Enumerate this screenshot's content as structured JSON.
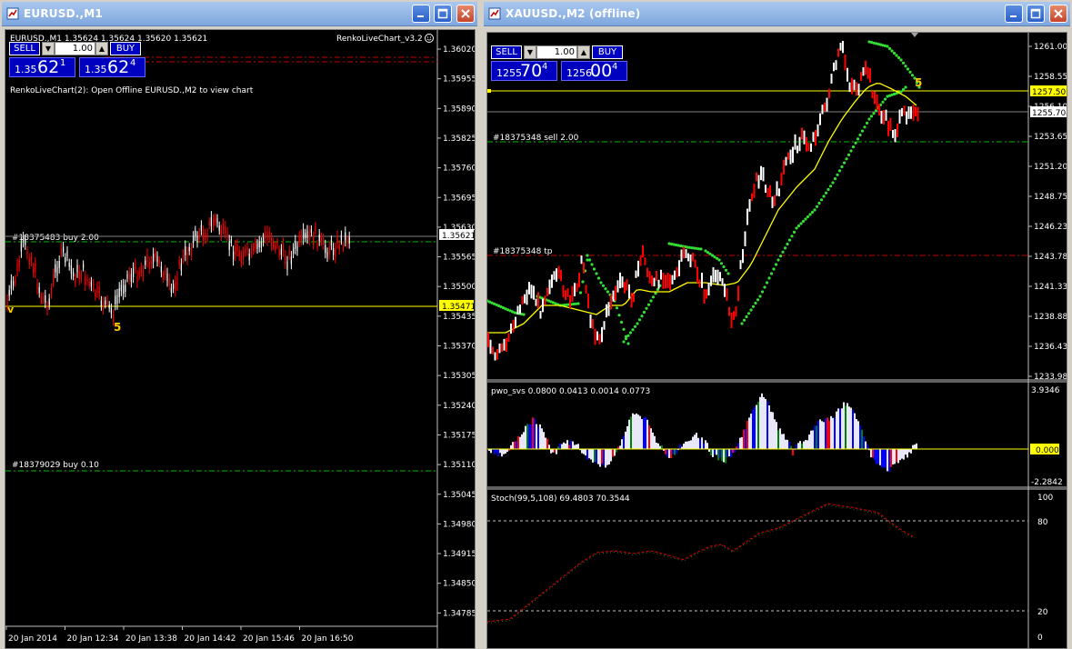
{
  "left_window": {
    "title": "EURUSD.,M1",
    "info_line": "EURUSD.,M1  1.35624 1.35624 1.35620 1.35621",
    "indicator_name": "RenkoLiveChart_v3.2",
    "comment": "RenkoLiveChart(2): Open Offline EURUSD.,M2 to view chart",
    "trade_panel": {
      "sell_label": "SELL",
      "buy_label": "BUY",
      "lot": "1.00",
      "sell_small": "1.35",
      "sell_big": "62",
      "sell_pip": "1",
      "buy_small": "1.35",
      "buy_big": "62",
      "buy_pip": "4"
    },
    "price_axis": [
      "1.36020",
      "1.35955",
      "1.35890",
      "1.35825",
      "1.35760",
      "1.35695",
      "1.35630",
      "1.35565",
      "1.35500",
      "1.35435",
      "1.35370",
      "1.35305",
      "1.35240",
      "1.35175",
      "1.35110",
      "1.35045",
      "1.34980",
      "1.34915",
      "1.34850",
      "1.34785"
    ],
    "current_price": "1.35621",
    "line_price": "1.35471",
    "order_lines": [
      {
        "label": "#18375483 buy 2.00"
      },
      {
        "label": "#18379029 buy 0.10"
      }
    ],
    "renko_marker": "5",
    "time_axis": [
      "20 Jan 2014",
      "20 Jan 12:34",
      "20 Jan 13:38",
      "20 Jan 14:42",
      "20 Jan 15:46",
      "20 Jan 16:50"
    ]
  },
  "right_window": {
    "title": "XAUUSD.,M2 (offline)",
    "trade_panel": {
      "sell_label": "SELL",
      "buy_label": "BUY",
      "lot": "1.00",
      "sell_small": "1255",
      "sell_big": "70",
      "sell_pip": "4",
      "buy_small": "1256",
      "buy_big": "00",
      "buy_pip": "4"
    },
    "price_axis": [
      "1261.000",
      "1258.550",
      "1256.100",
      "1253.650",
      "1251.200",
      "1248.750",
      "1246.230",
      "1243.780",
      "1241.330",
      "1238.880",
      "1236.430",
      "1233.980"
    ],
    "marked_price": "1257.503",
    "current_price": "1255.704",
    "order_lines": [
      {
        "label": "#18375348 sell 2.00"
      },
      {
        "label": "#18375348 tp"
      }
    ],
    "renko_marker": "5",
    "pwo": {
      "label": "pwo_svs 0.0800 0.0413 0.0014 0.0773",
      "axis_top": "3.9346",
      "axis_zero": "0.000",
      "axis_bottom": "-2.2842"
    },
    "stoch": {
      "label": "Stoch(99,5,108) 69.4803 70.3544",
      "axis": [
        "100",
        "80",
        "20",
        "0"
      ]
    }
  },
  "colors": {
    "bull": "#ffffff",
    "bear": "#ff0000",
    "ma_fast": "#ffff00",
    "band": "#33dd33",
    "order_green": "#00c000",
    "tp_red": "#c00000",
    "panel_blue": "#0000c0"
  }
}
